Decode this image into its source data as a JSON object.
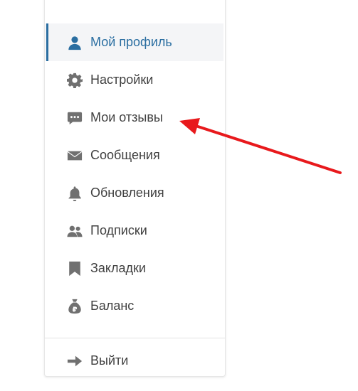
{
  "menu": {
    "items": [
      {
        "label": "Мой профиль",
        "icon": "user-icon",
        "active": true
      },
      {
        "label": "Настройки",
        "icon": "gear-icon",
        "active": false
      },
      {
        "label": "Мои отзывы",
        "icon": "comment-icon",
        "active": false
      },
      {
        "label": "Сообщения",
        "icon": "envelope-icon",
        "active": false
      },
      {
        "label": "Обновления",
        "icon": "bell-icon",
        "active": false
      },
      {
        "label": "Подписки",
        "icon": "users-icon",
        "active": false
      },
      {
        "label": "Закладки",
        "icon": "bookmark-icon",
        "active": false
      },
      {
        "label": "Баланс",
        "icon": "money-bag-icon",
        "active": false
      }
    ],
    "logout": {
      "label": "Выйти",
      "icon": "arrow-right-icon"
    }
  },
  "colors": {
    "accent": "#2a6ea1",
    "icon": "#707070",
    "text": "#404040",
    "annotation_arrow": "#e8191c"
  }
}
